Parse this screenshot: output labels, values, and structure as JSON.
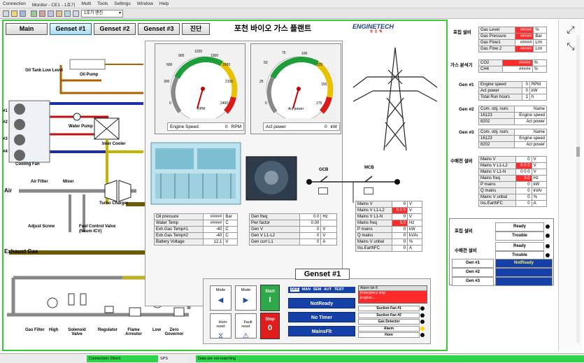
{
  "menu": [
    "Connection",
    "Monitor - CE1 - 1호기",
    "Multi",
    "Tools",
    "Settings",
    "Window",
    "Help"
  ],
  "toolbar": {
    "selector": "1호기 엔진"
  },
  "nav": {
    "main": "Main",
    "g1": "Genset #1",
    "g2": "Genset #2",
    "g3": "Genset #3",
    "diag": "진단"
  },
  "title": "포천 바이오 가스 플랜트",
  "logo": {
    "name": "ENGINETECH",
    "sub": "엔진텍"
  },
  "gauges": {
    "speed": {
      "label": "Engine Speed",
      "value": "0",
      "unit": "RPM",
      "ticks": [
        "0",
        "300",
        "600",
        "900",
        "1200",
        "1500",
        "1800",
        "2100",
        "2400"
      ],
      "face_unit": "RPM"
    },
    "power": {
      "label": "Act power",
      "value": "0",
      "unit": "kW",
      "ticks": [
        "0",
        "25",
        "50",
        "75",
        "100",
        "125",
        "150",
        "175"
      ],
      "face_unit": "Act power"
    }
  },
  "schematic": {
    "oil_tank": "Oil Tank Low Level",
    "oil_pump": "Oil Pump",
    "water_pump": "Water Pump",
    "intercooler": "Inter Cooler",
    "cooling_fan": "Cooling Fan",
    "air": "Air",
    "air_filter": "Air Filter",
    "mixer": "Mixer",
    "turbo": "Turbo Charger",
    "adjust_screw": "Adjust Screw",
    "fuel_valve": "Fuel Control Valve\n(Neum ICV)",
    "exhaust": "Exhaust Gas",
    "gcb": "GCB",
    "mcb": "MCB",
    "fan_labels": [
      "#1",
      "#2",
      "#3",
      "#4"
    ],
    "gas_train": [
      "Gas Filter",
      "High",
      "Solenoid Valve",
      "Regulator",
      "Flame Arrestor",
      "Low",
      "Zero Governor"
    ]
  },
  "engine_table": [
    {
      "label": "Oil pressure",
      "value": "#####",
      "unit": "Bar"
    },
    {
      "label": "Water Temp",
      "value": "#####",
      "unit": "C"
    },
    {
      "label": "Exh.Gas Temp#1",
      "value": "-40",
      "unit": "C"
    },
    {
      "label": "Exh.Gas Temp#2",
      "value": "-40",
      "unit": "C"
    },
    {
      "label": "Battery Voltage",
      "value": "12.1",
      "unit": "V"
    }
  ],
  "gen_table": [
    {
      "label": "Gen freq",
      "value": "0.0",
      "unit": "Hz"
    },
    {
      "label": "Pwr factor",
      "value": "0.00",
      "unit": ""
    },
    {
      "label": "Gen V",
      "value": "0",
      "unit": "V"
    },
    {
      "label": "Gen V L1-L2",
      "value": "0",
      "unit": "V"
    },
    {
      "label": "Gen curr L1",
      "value": "0",
      "unit": "A"
    }
  ],
  "mains_table": [
    {
      "label": "Mains V",
      "value": "0",
      "unit": "V",
      "red": false
    },
    {
      "label": "Mains V L1-L2",
      "value": "0 0 0",
      "unit": "V",
      "red": true
    },
    {
      "label": "Mains V L1-N",
      "value": "0",
      "unit": "V",
      "red": false
    },
    {
      "label": "Mains freq",
      "value": "0.0",
      "unit": "Hz",
      "red": true
    },
    {
      "label": "P mains",
      "value": "0",
      "unit": "kW",
      "red": false
    },
    {
      "label": "Q mains",
      "value": "0",
      "unit": "kVAr",
      "red": false
    },
    {
      "label": "Mains V unbal",
      "value": "0",
      "unit": "%",
      "red": false
    },
    {
      "label": "Ins.EarthFC",
      "value": "0",
      "unit": "A",
      "red": false
    }
  ],
  "genset_panel": {
    "title": "Genset #1",
    "mode1": "Mode",
    "mode2": "Mode",
    "horn": "Horn\nreset",
    "fault": "Fault\nreset",
    "start": "Start",
    "start_val": "I",
    "stop": "Stop",
    "stop_val": "0",
    "modes": [
      "OFF",
      "MAN",
      "SEM",
      "AUT",
      "TEST"
    ],
    "status": [
      "NotReady",
      "No Timer",
      "MainsFlt"
    ],
    "alarm_hdr": "Alarm list 8",
    "alarm_item": "Emergency stop\nEnginer...",
    "leds": [
      "Suction Fan #1",
      "Suction Fan #2",
      "Gas Detector",
      "Alarm",
      "Horn"
    ]
  },
  "right": {
    "fuel_hdr": "포집 설비",
    "fuel_rows": [
      {
        "label": "Gas Level",
        "value": "#####",
        "unit": "%",
        "red": true
      },
      {
        "label": "Gas Pressure",
        "value": "#####",
        "unit": "Bar",
        "red": true
      },
      {
        "label": "Gas Flow1",
        "value": "#####",
        "unit": "L/m",
        "red": false
      },
      {
        "label": "Gas Flow 2",
        "value": "#####",
        "unit": "L/m",
        "red": true
      }
    ],
    "gas_hdr": "가스 분석기",
    "gas_rows": [
      {
        "label": "CO2",
        "value": "#####",
        "unit": "%",
        "red": true
      },
      {
        "label": "CH4",
        "value": "#####",
        "unit": "%",
        "red": false
      }
    ],
    "gen1_hdr": "Gen #1",
    "gen1_rows": [
      {
        "label": "Engine speed",
        "value": "0",
        "unit": "RPM"
      },
      {
        "label": "Act power",
        "value": "0",
        "unit": "kW"
      },
      {
        "label": "Total Run hours",
        "value": "1",
        "unit": "h"
      }
    ],
    "gen2_hdr": "Gen #2",
    "gen2_rows": [
      {
        "label": "Com. obj. num.",
        "value": "Name"
      },
      {
        "label": "16123",
        "value": "Engine speed"
      },
      {
        "label": "8202",
        "value": "Act power"
      }
    ],
    "gen3_hdr": "Gen #3",
    "gen3_rows": [
      {
        "label": "Com. obj. num.",
        "value": "Name"
      },
      {
        "label": "16123",
        "value": "Engine speed"
      },
      {
        "label": "8202",
        "value": "Act power"
      }
    ],
    "sub_hdr": "수배전 설비",
    "sub_rows": [
      {
        "label": "Mains V",
        "value": "0",
        "unit": "V",
        "red": false
      },
      {
        "label": "Mains V L1-L2",
        "value": "0 0 0",
        "unit": "V",
        "red": true
      },
      {
        "label": "Mains V L1-N",
        "value": "0 0 0",
        "unit": "V",
        "red": false
      },
      {
        "label": "Mains freq",
        "value": "0.0",
        "unit": "Hz",
        "red": true
      },
      {
        "label": "P mains",
        "value": "0",
        "unit": "kW",
        "red": false
      },
      {
        "label": "Q mains",
        "value": "0",
        "unit": "kVAr",
        "red": false
      },
      {
        "label": "Mains V unbal",
        "value": "0",
        "unit": "%",
        "red": false
      },
      {
        "label": "Ins.EarthFC",
        "value": "0",
        "unit": "A",
        "red": false
      }
    ],
    "status1_hdr": "포집 설비",
    "status2_hdr": "수배전 설비",
    "ready": "Ready",
    "trouble": "Trouble",
    "gens": [
      {
        "label": "Gen #1",
        "value": "NotReady"
      },
      {
        "label": "Gen #2",
        "value": ""
      },
      {
        "label": "Gen #3",
        "value": ""
      }
    ]
  },
  "statusbar": {
    "conn": "Connection: Direct",
    "sps": "SPS",
    "msg": "Data are not matching"
  }
}
